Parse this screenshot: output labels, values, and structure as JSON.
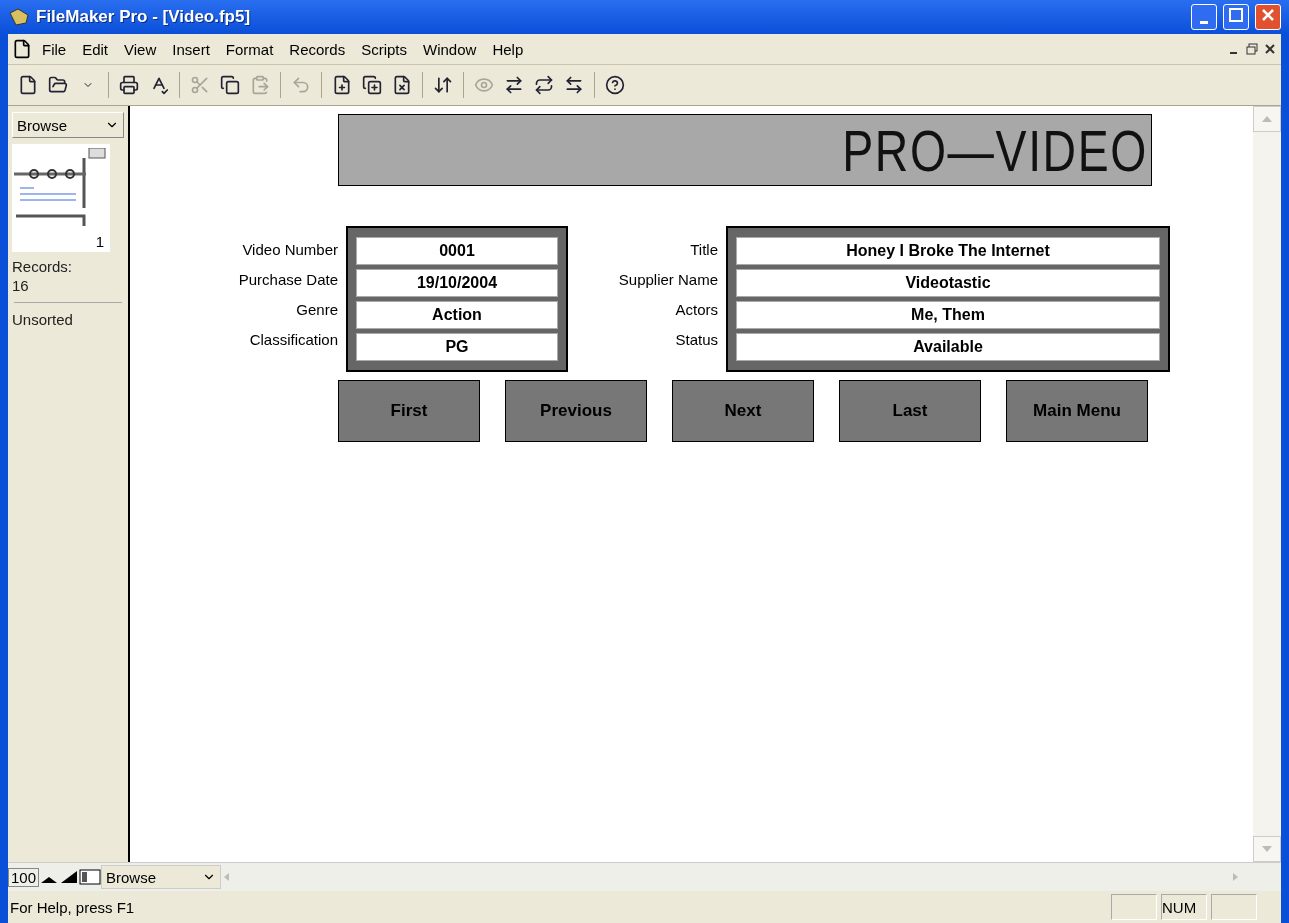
{
  "window": {
    "title": "FileMaker Pro - [Video.fp5]"
  },
  "menu": [
    "File",
    "Edit",
    "View",
    "Insert",
    "Format",
    "Records",
    "Scripts",
    "Window",
    "Help"
  ],
  "toolbar": [
    {
      "disabled": false
    },
    {
      "disabled": false
    },
    {
      "disabled": false
    },
    {
      "disabled": false
    },
    {
      "disabled": false
    },
    {
      "disabled": true
    },
    {
      "disabled": false
    },
    {
      "disabled": true
    },
    {
      "disabled": true
    },
    {
      "disabled": false
    },
    {
      "disabled": false
    },
    {
      "disabled": false
    },
    {
      "disabled": false
    },
    {
      "disabled": true
    },
    {
      "disabled": false
    },
    {
      "disabled": false
    },
    {
      "disabled": false
    },
    {
      "disabled": false
    }
  ],
  "status_area": {
    "mode": "Browse",
    "record_number": "1",
    "records_label": "Records:",
    "records_count": "16",
    "sort_state": "Unsorted"
  },
  "layout": {
    "banner": "PRO—VIDEO",
    "left_fields": [
      {
        "label": "Video Number",
        "value": "0001"
      },
      {
        "label": "Purchase Date",
        "value": "19/10/2004"
      },
      {
        "label": "Genre",
        "value": "Action"
      },
      {
        "label": "Classification",
        "value": "PG"
      }
    ],
    "right_fields": [
      {
        "label": "Title",
        "value": "Honey I Broke The Internet"
      },
      {
        "label": "Supplier Name",
        "value": "Videotastic"
      },
      {
        "label": "Actors",
        "value": "Me, Them"
      },
      {
        "label": "Status",
        "value": "Available"
      }
    ],
    "buttons": [
      "First",
      "Previous",
      "Next",
      "Last",
      "Main Menu"
    ]
  },
  "bottom_bar": {
    "zoom": "100",
    "mode": "Browse"
  },
  "status_bar": {
    "help": "For Help, press F1",
    "indicators": [
      "NUM"
    ]
  }
}
